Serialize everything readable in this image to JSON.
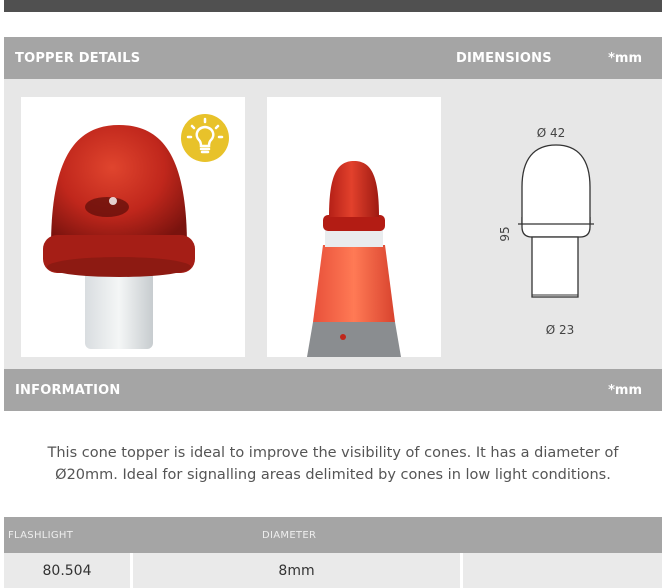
{
  "header": {
    "details_title": "TOPPER DETAILS",
    "dimensions_title": "DIMENSIONS",
    "unit": "*mm"
  },
  "diagram": {
    "top_diameter": "Ø 42",
    "bottom_diameter": "Ø 23",
    "height": "95"
  },
  "information": {
    "title": "INFORMATION",
    "unit": "*mm",
    "text": "This cone topper is ideal to improve the visibility of cones. It has a diameter of Ø20mm. Ideal for signalling areas delimited by cones in low light conditions."
  },
  "table": {
    "headers": [
      "FLASHLIGHT",
      "DIAMETER"
    ],
    "rows": [
      [
        "80.504",
        "8mm",
        ""
      ]
    ]
  },
  "icons": {
    "light_badge": "lightbulb-icon"
  },
  "colors": {
    "bar": "#a5a5a5",
    "badge": "#e8c22a",
    "lamp_red": "#c0271c",
    "cone_orange": "#f05a3c"
  }
}
